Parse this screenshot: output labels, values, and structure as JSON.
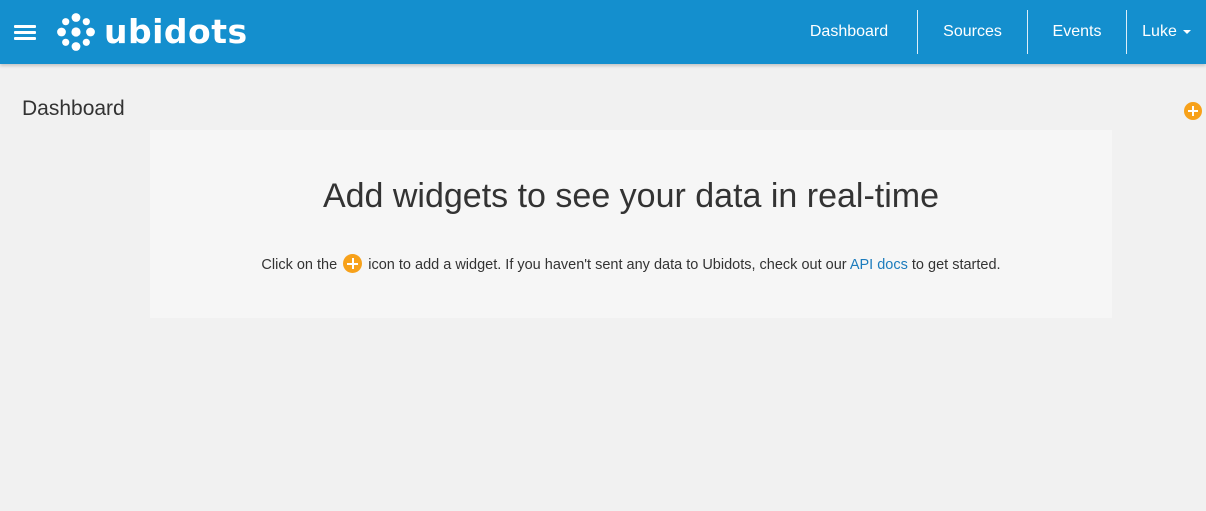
{
  "brand": {
    "name": "ubidots",
    "color": "#148fce",
    "accent": "#f7a11a"
  },
  "nav": {
    "dashboard_label": "Dashboard",
    "sources_label": "Sources",
    "events_label": "Events",
    "user_label": "Luke"
  },
  "page": {
    "title": "Dashboard",
    "add_widget_icon": "plus-circle-icon"
  },
  "empty_state": {
    "heading": "Add widgets to see your data in real-time",
    "text_before": "Click on the",
    "text_middle": "icon to add a widget. If you haven't sent any data to Ubidots, check out our",
    "link_label": "API docs",
    "text_after": "to get started."
  }
}
